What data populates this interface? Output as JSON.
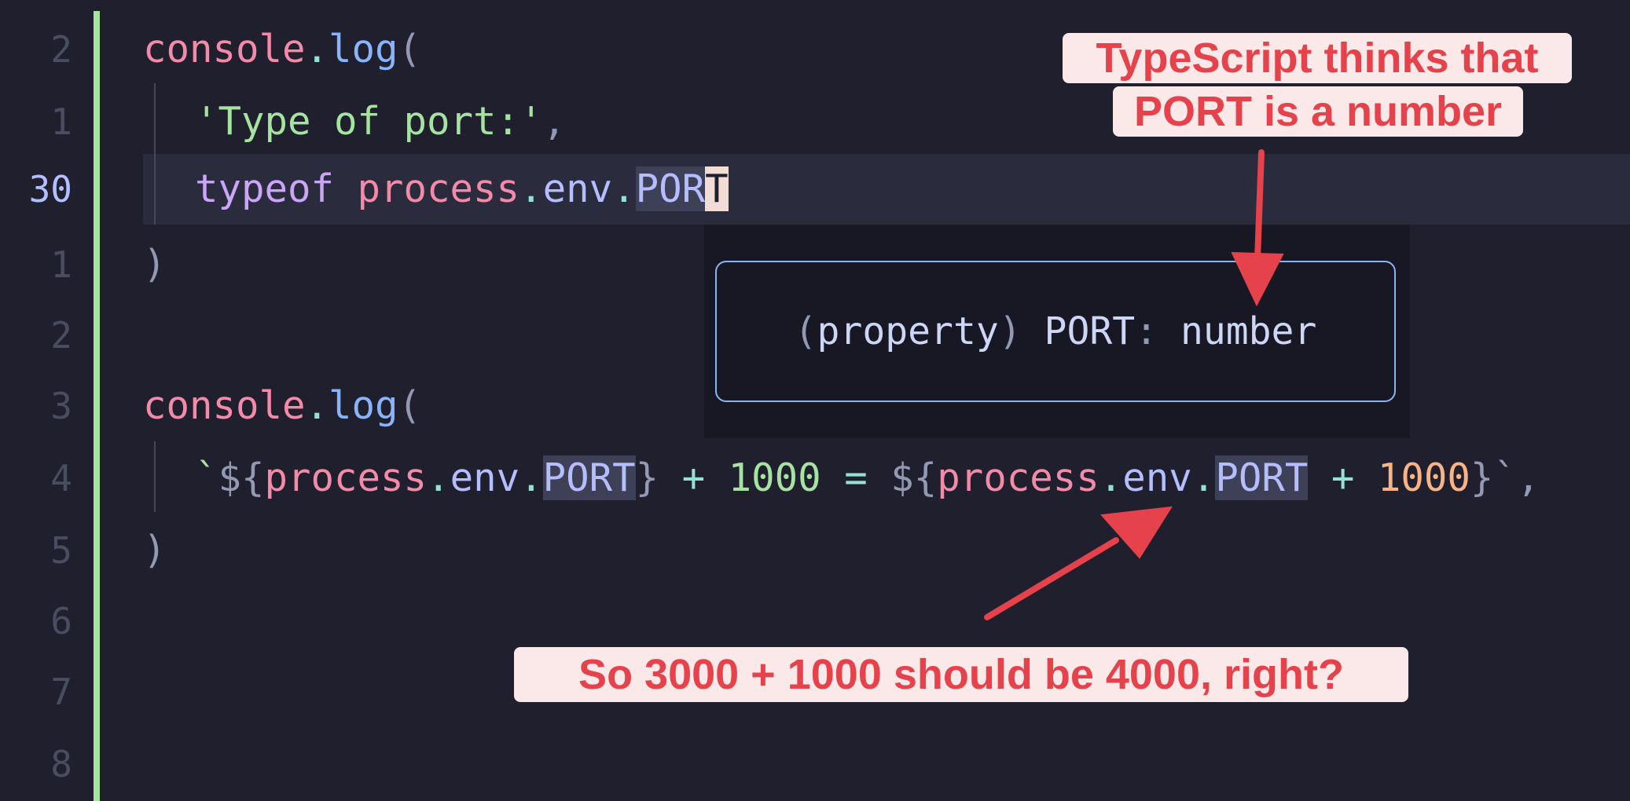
{
  "editor": {
    "lines": [
      {
        "num": "2"
      },
      {
        "num": "1"
      },
      {
        "num": "30"
      },
      {
        "num": "1"
      },
      {
        "num": "2"
      },
      {
        "num": "3"
      },
      {
        "num": "4"
      },
      {
        "num": "5"
      },
      {
        "num": "6"
      },
      {
        "num": "7"
      },
      {
        "num": "8"
      }
    ],
    "code": {
      "console": "console",
      "dot": ".",
      "log": "log",
      "open_paren": "(",
      "close_paren": ")",
      "string_type_of_port": "'Type of port:'",
      "comma": ",",
      "typeof": "typeof",
      "process": "process",
      "env": "env",
      "port_prefix": "POR",
      "port_cursor_char": "T",
      "PORT": "PORT",
      "backtick": "`",
      "template_open": "${",
      "template_close": "}",
      "plus": "+",
      "num_1000": "1000",
      "equals": "=",
      "template_end": "}`,"
    },
    "hover": {
      "open_paren": "(",
      "kind": "property",
      "close_paren": ")",
      "name": "PORT",
      "colon": ":",
      "type": "number"
    }
  },
  "annotations": {
    "top_line1": "TypeScript thinks that",
    "top_line2": "PORT is a number",
    "bottom": "So 3000 + 1000 should be 4000, right?",
    "color": "#e5424b",
    "background": "#fbe9e9"
  },
  "theme": {
    "background": "#1f1f2e",
    "git_added": "#a6e3a1",
    "hover_border": "#89b4fa"
  }
}
